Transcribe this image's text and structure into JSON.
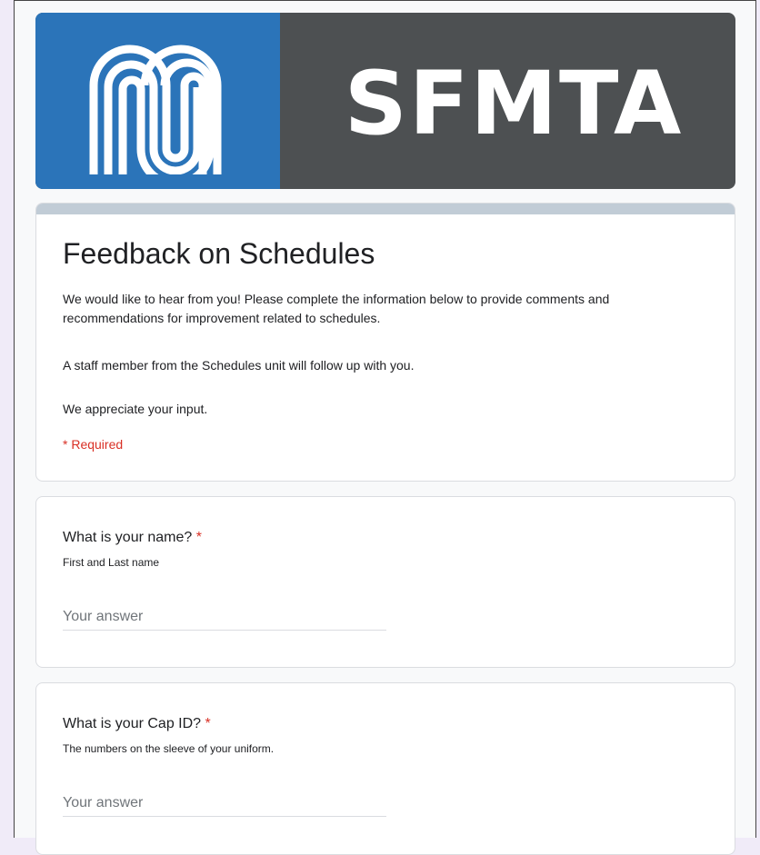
{
  "banner": {
    "logo_icon": "sfmta-worm-logo-icon",
    "wordmark": "SFMTA",
    "colors": {
      "left_panel": "#2b74b9",
      "right_panel": "#4d5052"
    }
  },
  "form": {
    "title": "Feedback on Schedules",
    "description_1": "We would like to hear from you!  Please complete the information below to provide comments and recommendations for improvement related to schedules.",
    "description_2": "A staff member from the Schedules unit will follow up with you.",
    "description_3": "We appreciate your input.",
    "required_note": "* Required",
    "accent_color": "#c1ccd6",
    "required_color": "#d93025"
  },
  "questions": [
    {
      "title": "What is your name?",
      "required_mark": "*",
      "help": "First and Last name",
      "placeholder": "Your answer",
      "value": ""
    },
    {
      "title": "What is your Cap ID?",
      "required_mark": "*",
      "help": "The numbers on the sleeve of your uniform.",
      "placeholder": "Your answer",
      "value": ""
    }
  ]
}
